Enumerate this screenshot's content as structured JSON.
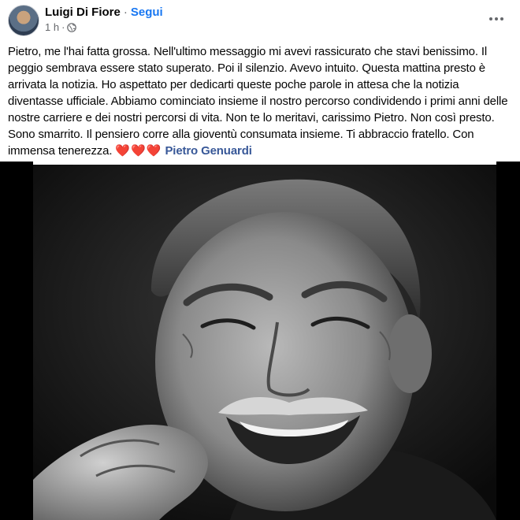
{
  "post": {
    "author": {
      "name": "Luigi Di Fiore",
      "separator": "·",
      "follow_label": "Segui",
      "avatar_icon": "profile-avatar"
    },
    "meta": {
      "time": "1 h",
      "separator": "·",
      "audience_icon": "globe-icon"
    },
    "more_icon": "more-horizontal-icon",
    "text_lines": [
      "Pietro, me l'hai fatta grossa. Nell'ultimo messaggio mi avevi rassicurato che stavi benissimo. Il",
      "peggio sembrava essere stato superato. Poi il silenzio. Avevo intuito. Questa mattina presto è",
      "arrivata la notizia. Ho aspettato  per dedicarti queste poche parole in attesa che la notizia",
      "diventasse ufficiale. Abbiamo cominciato insieme il nostro percorso condividendo i primi anni delle",
      "nostre carriere e dei nostri percorsi di vita. Non te lo meritavi, carissimo Pietro. Non così presto.",
      "Sono smarrito. Il pensiero corre alla gioventù consumata insieme. Ti abbraccio fratello. Con",
      "immensa tenerezza."
    ],
    "hearts": "❤️❤️❤️",
    "tagged_person": "Pietro Genuardi",
    "photo_description_icon": "portrait-photo"
  },
  "colors": {
    "link_blue": "#1877f2",
    "tag_blue": "#385898",
    "secondary_text": "#65676b",
    "heart_red": "#e02b3d"
  }
}
